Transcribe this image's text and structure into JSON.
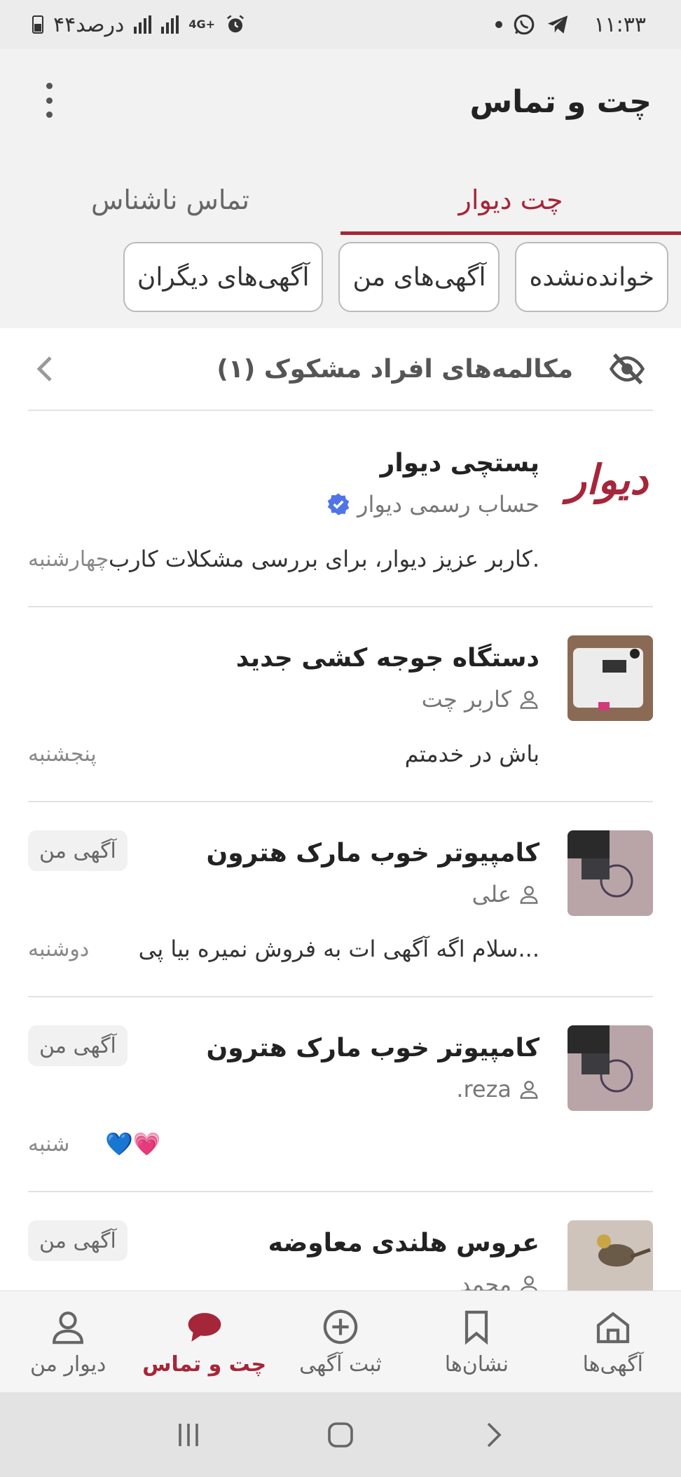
{
  "status_bar": {
    "time": "۱۱:۳۳",
    "battery": "۴۴درصد",
    "network": "4G+"
  },
  "header": {
    "title": "چت و تماس"
  },
  "tabs": [
    {
      "label": "چت دیوار",
      "active": true
    },
    {
      "label": "تماس ناشناس",
      "active": false
    }
  ],
  "filters": [
    {
      "label": "خوانده‌نشده"
    },
    {
      "label": "آگهی‌های من"
    },
    {
      "label": "آگهی‌های دیگران"
    }
  ],
  "suspicious": {
    "label": "مکالمه‌های افراد مشکوک (۱)"
  },
  "chats": [
    {
      "title": "پستچی دیوار",
      "subtitle": "حساب رسمی دیوار",
      "message": "کاربر عزیز دیوار، برای بررسی مشکلات کارب.",
      "day": "چهارشنبه",
      "logo_text": "دیوار",
      "verified": true
    },
    {
      "title": "دستگاه جوجه کشی جدید",
      "subtitle": "کاربر چت",
      "message": "باش در خدمتم",
      "day": "پنجشنبه"
    },
    {
      "title": "کامپیوتر خوب مارک هترون",
      "subtitle": "علی",
      "message": "سلام  اگه آگهی ات به فروش نمیره بیا پی...",
      "day": "دوشنبه",
      "badge": "آگهی من"
    },
    {
      "title": "کامپیوتر خوب مارک هترون",
      "subtitle": "reza.",
      "message": "💙💗",
      "day": "شنبه",
      "badge": "آگهی من"
    },
    {
      "title": "عروس هلندی معاوضه",
      "subtitle": "محمد",
      "message": "",
      "day": "",
      "badge": "آگهی من"
    }
  ],
  "bottom_nav": [
    {
      "label": "آگهی‌ها",
      "icon": "home-icon",
      "active": false
    },
    {
      "label": "نشان‌ها",
      "icon": "bookmark-icon",
      "active": false
    },
    {
      "label": "ثبت آگهی",
      "icon": "add-circle-icon",
      "active": false
    },
    {
      "label": "چت و تماس",
      "icon": "chat-icon",
      "active": true
    },
    {
      "label": "دیوار من",
      "icon": "user-icon",
      "active": false
    }
  ],
  "colors": {
    "brand": "#a62639",
    "badge_bg": "#f1f1f1"
  }
}
